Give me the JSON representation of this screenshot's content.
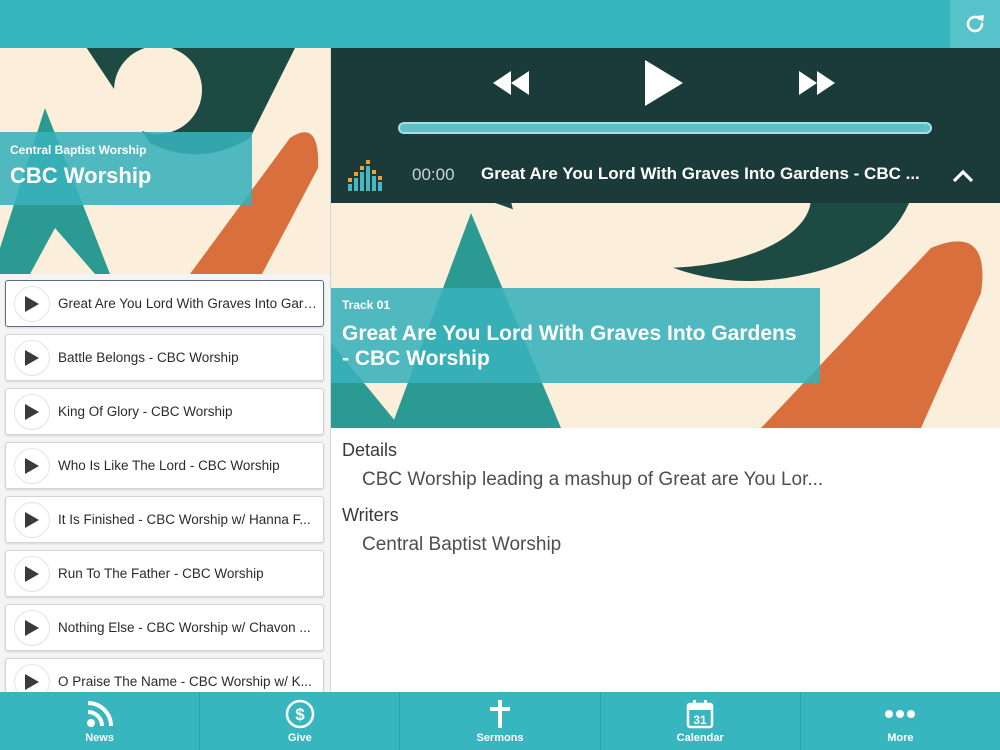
{
  "album": {
    "subtitle": "Central Baptist Worship",
    "title": "CBC Worship"
  },
  "tracks": [
    {
      "title": "Great Are You Lord With Graves Into Gardens - CBC Worship",
      "active": true
    },
    {
      "title": "Battle Belongs - CBC Worship"
    },
    {
      "title": "King Of Glory - CBC Worship"
    },
    {
      "title": "Who Is Like The Lord - CBC Worship"
    },
    {
      "title": "It Is Finished - CBC Worship w/ Hanna F..."
    },
    {
      "title": "Run To The Father - CBC Worship"
    },
    {
      "title": "Nothing Else - CBC Worship w/ Chavon ..."
    },
    {
      "title": "O Praise The Name - CBC Worship w/ K..."
    }
  ],
  "player": {
    "time": "00:00",
    "now_playing": "Great Are You Lord With Graves Into Gardens - CBC ...",
    "progress": 0
  },
  "current_track": {
    "number_label": "Track 01",
    "title": "Great Are You Lord With Graves Into Gardens - CBC Worship"
  },
  "details": {
    "details_heading": "Details",
    "details_text": "CBC Worship leading a mashup of Great are You Lor...",
    "writers_heading": "Writers",
    "writers_text": "Central Baptist Worship"
  },
  "nav": [
    {
      "label": "News",
      "icon": "rss-icon"
    },
    {
      "label": "Give",
      "icon": "dollar-icon"
    },
    {
      "label": "Sermons",
      "icon": "cross-icon"
    },
    {
      "label": "Calendar",
      "icon": "calendar-icon",
      "day": "31"
    },
    {
      "label": "More",
      "icon": "more-icon"
    }
  ],
  "colors": {
    "accent": "#38b6bf",
    "player_bg": "#1b3b3a",
    "art_teal": "#2b9a92",
    "art_dark": "#1d4b44",
    "art_orange": "#d86f3c",
    "art_cream": "#fbeedb"
  }
}
